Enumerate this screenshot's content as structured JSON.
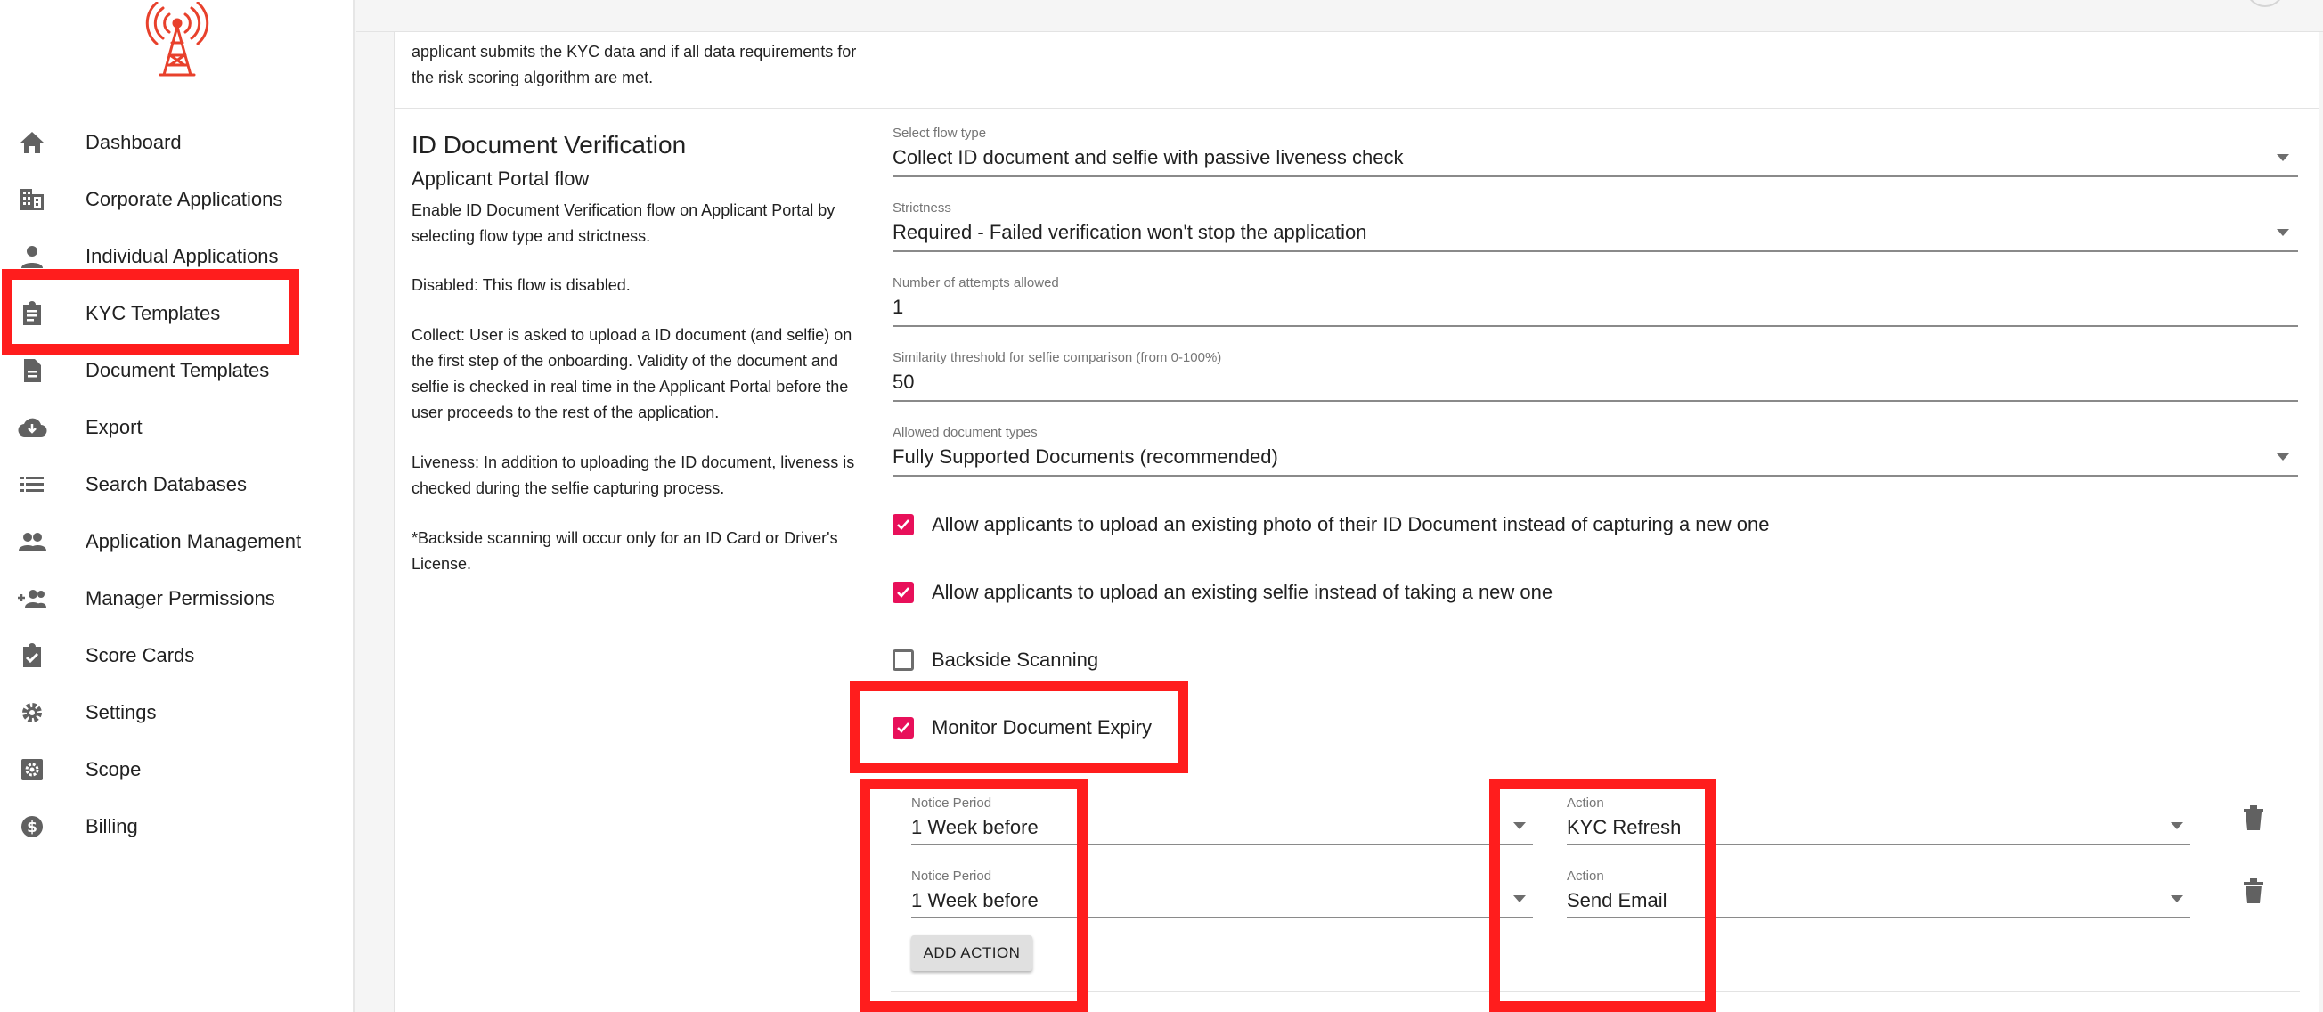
{
  "sidebar": {
    "logo_icon": "radio-tower-icon",
    "items": [
      {
        "label": "Dashboard",
        "icon": "home-icon"
      },
      {
        "label": "Corporate Applications",
        "icon": "building-icon"
      },
      {
        "label": "Individual Applications",
        "icon": "person-icon"
      },
      {
        "label": "KYC Templates",
        "icon": "clipboard-icon"
      },
      {
        "label": "Document Templates",
        "icon": "document-icon"
      },
      {
        "label": "Export",
        "icon": "cloud-download-icon"
      },
      {
        "label": "Search Databases",
        "icon": "list-icon"
      },
      {
        "label": "Application Management",
        "icon": "people-icon"
      },
      {
        "label": "Manager Permissions",
        "icon": "person-add-icon"
      },
      {
        "label": "Score Cards",
        "icon": "clipboard-check-icon"
      },
      {
        "label": "Settings",
        "icon": "gear-icon"
      },
      {
        "label": "Scope",
        "icon": "settings-box-icon"
      },
      {
        "label": "Billing",
        "icon": "dollar-icon"
      }
    ]
  },
  "top_text": "applicant submits the KYC data and if all data requirements for the risk scoring algorithm are met.",
  "section": {
    "title": "ID Document Verification",
    "subtitle": "Applicant Portal flow",
    "desc1": "Enable ID Document Verification flow on Applicant Portal by selecting flow type and strictness.",
    "desc2": "Disabled: This flow is disabled.",
    "desc3": "Collect: User is asked to upload a ID document (and selfie) on the first step of the onboarding. Validity of the document and selfie is checked in real time in the Applicant Portal before the user proceeds to the rest of the application.",
    "desc4": "Liveness: In addition to uploading the ID document, liveness is checked during the selfie capturing process.",
    "desc5": "*Backside scanning will occur only for an ID Card or Driver's License."
  },
  "fields": {
    "flow_type": {
      "label": "Select flow type",
      "value": "Collect ID document and selfie with passive liveness check"
    },
    "strictness": {
      "label": "Strictness",
      "value": "Required - Failed verification won't stop the application"
    },
    "attempts": {
      "label": "Number of attempts allowed",
      "value": "1"
    },
    "similarity": {
      "label": "Similarity threshold for selfie comparison (from 0-100%)",
      "value": "50"
    },
    "doc_types": {
      "label": "Allowed document types",
      "value": "Fully Supported Documents (recommended)"
    }
  },
  "checkboxes": {
    "upload_photo": {
      "label": "Allow applicants to upload an existing photo of their ID Document instead of capturing a new one",
      "checked": true
    },
    "upload_selfie": {
      "label": "Allow applicants to upload an existing selfie instead of taking a new one",
      "checked": true
    },
    "backside": {
      "label": "Backside Scanning",
      "checked": false
    },
    "expiry": {
      "label": "Monitor Document Expiry",
      "checked": true
    }
  },
  "expiry_actions": [
    {
      "notice_label": "Notice Period",
      "notice_value": "1 Week before",
      "action_label": "Action",
      "action_value": "KYC Refresh"
    },
    {
      "notice_label": "Notice Period",
      "notice_value": "1 Week before",
      "action_label": "Action",
      "action_value": "Send Email"
    }
  ],
  "add_action_label": "ADD ACTION",
  "colors": {
    "accent": "#e8105a",
    "highlight": "#ff1d1d",
    "logo": "#e8412c"
  }
}
